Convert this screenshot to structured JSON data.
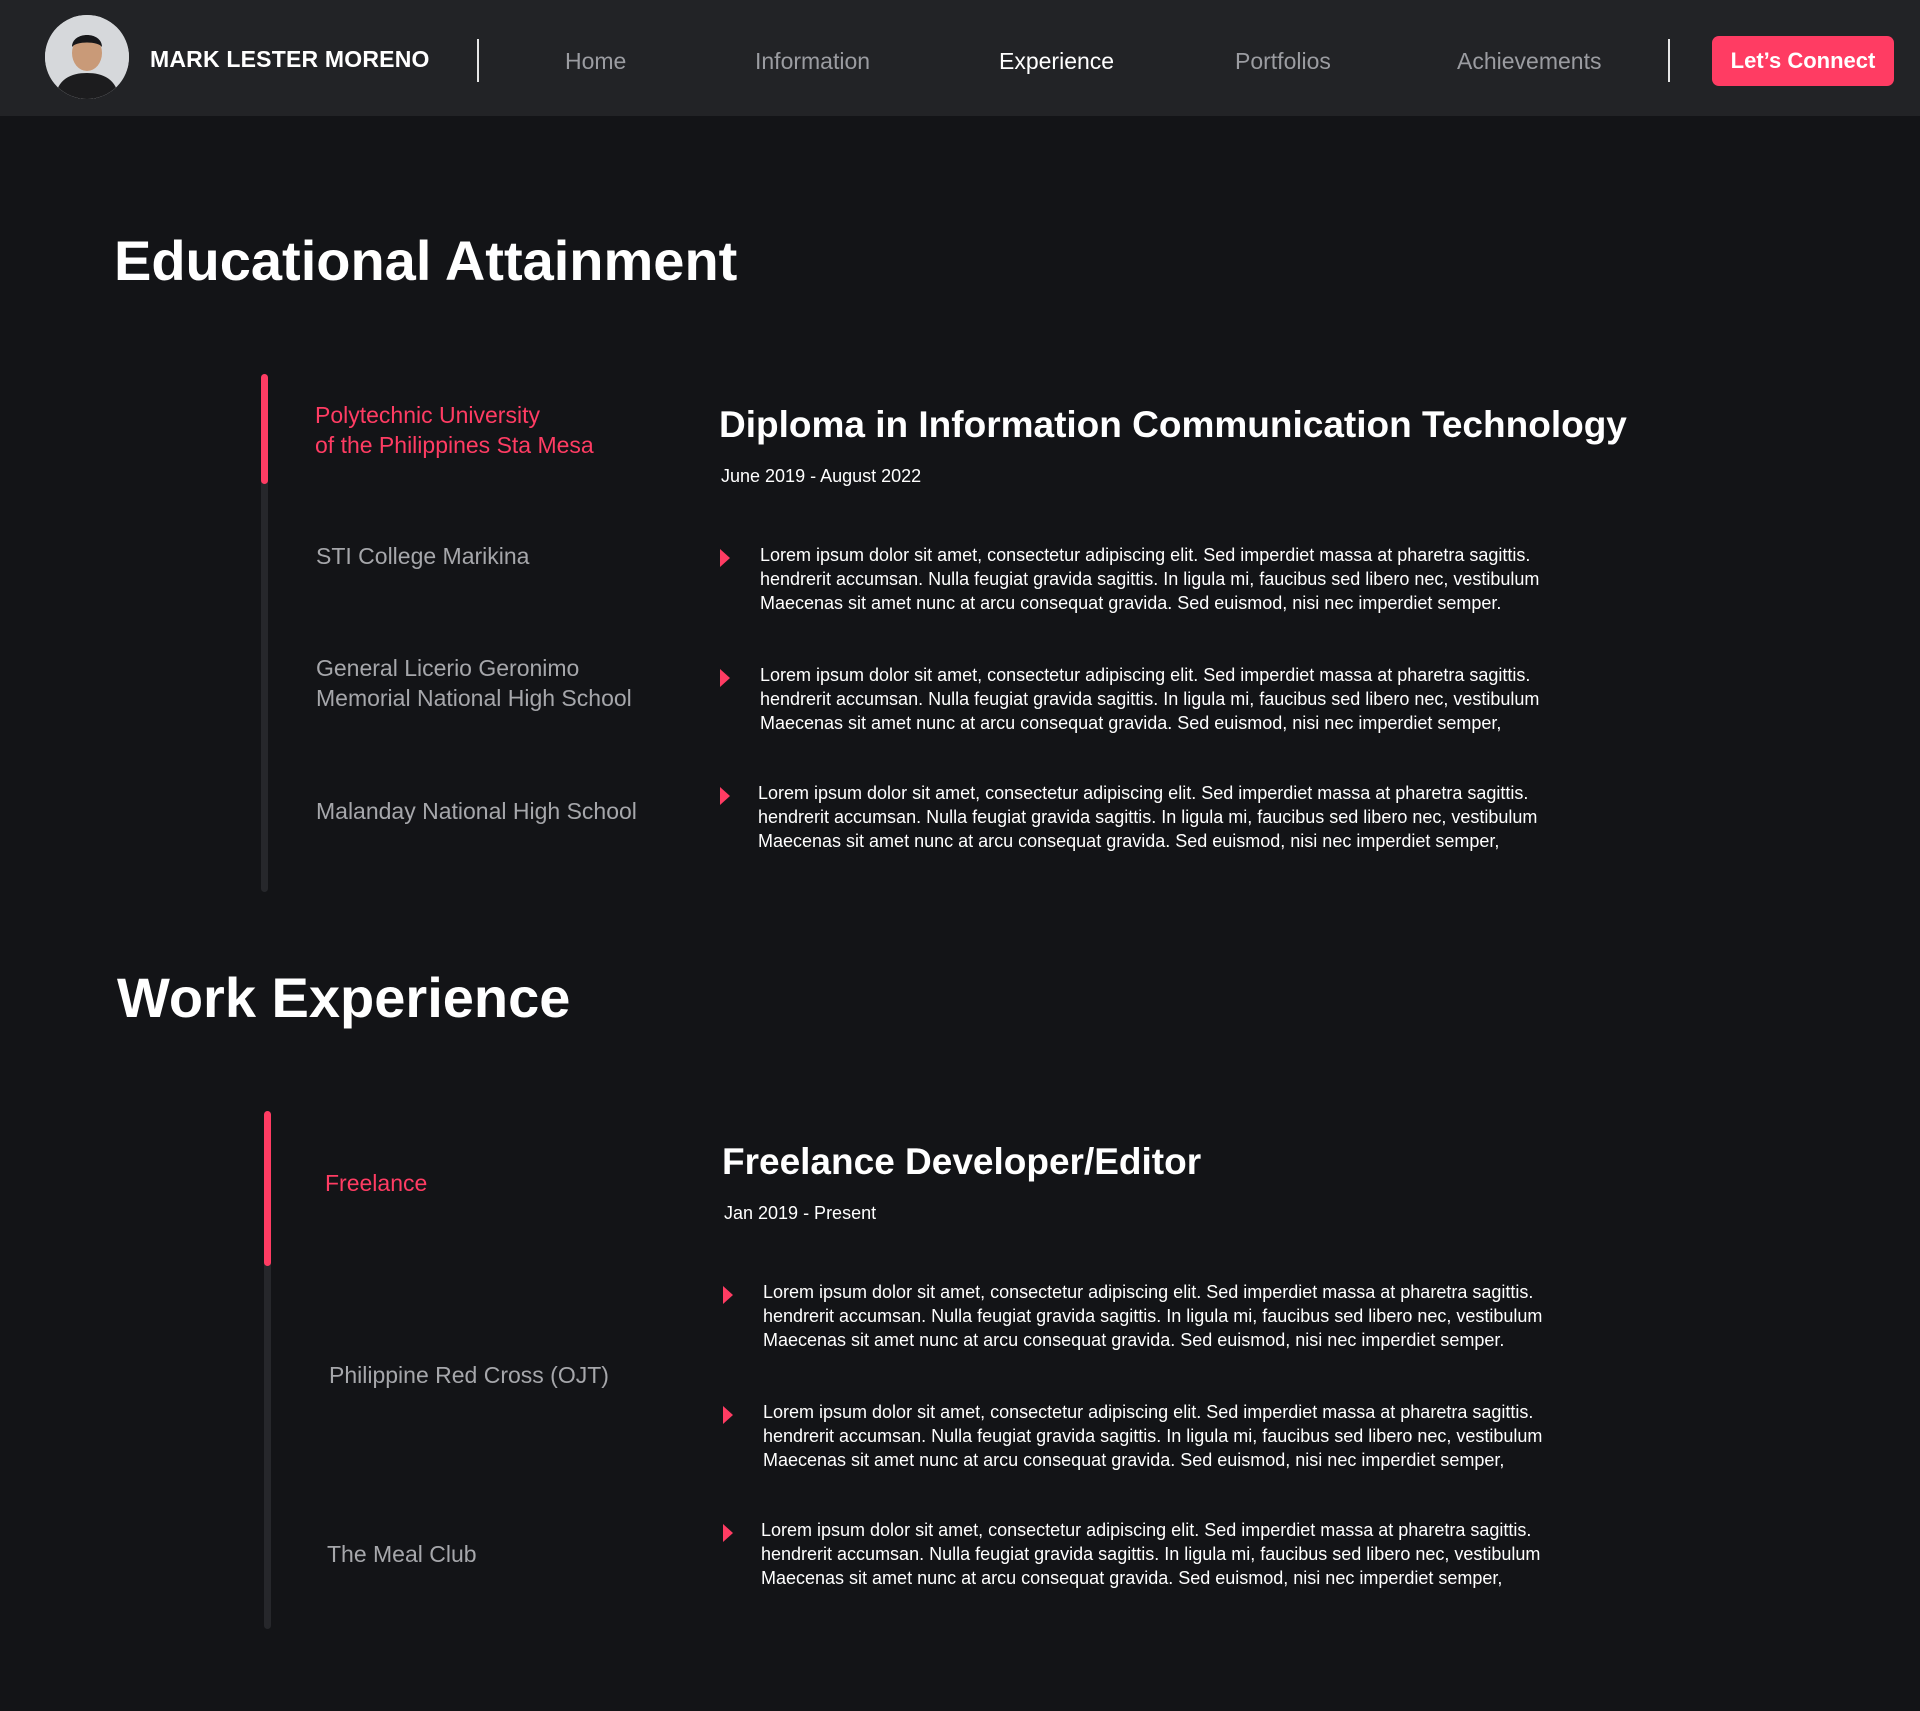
{
  "nav": {
    "brand_name": "MARK LESTER MORENO",
    "links": [
      "Home",
      "Information",
      "Experience",
      "Portfolios",
      "Achievements"
    ],
    "active_link": "Experience",
    "cta_label": "Let’s Connect",
    "accent_color": "#ff3c63"
  },
  "education": {
    "title": "Educational Attainment",
    "schools": [
      {
        "lines": [
          "Polytechnic University",
          "of the Philippines Sta Mesa"
        ],
        "active": true
      },
      {
        "lines": [
          "STI College Marikina"
        ],
        "active": false
      },
      {
        "lines": [
          "General Licerio Geronimo",
          "Memorial National High School"
        ],
        "active": false
      },
      {
        "lines": [
          "Malanday National High School"
        ],
        "active": false
      }
    ],
    "detail": {
      "title": "Diploma in Information Communication Technology",
      "date": "June 2019 - August 2022",
      "bullets": [
        [
          "Lorem ipsum dolor sit amet, consectetur adipiscing elit. Sed imperdiet massa at pharetra sagittis.",
          "hendrerit accumsan. Nulla feugiat gravida sagittis. In ligula mi, faucibus sed libero nec, vestibulum",
          "Maecenas sit amet nunc at arcu consequat gravida. Sed euismod, nisi nec imperdiet semper."
        ],
        [
          "Lorem ipsum dolor sit amet, consectetur adipiscing elit. Sed imperdiet massa at pharetra sagittis.",
          "hendrerit accumsan. Nulla feugiat gravida sagittis. In ligula mi, faucibus sed libero nec, vestibulum",
          "Maecenas sit amet nunc at arcu consequat gravida. Sed euismod, nisi nec imperdiet semper,"
        ],
        [
          "Lorem ipsum dolor sit amet, consectetur adipiscing elit. Sed imperdiet massa at pharetra sagittis.",
          "hendrerit accumsan. Nulla feugiat gravida sagittis. In ligula mi, faucibus sed libero nec, vestibulum",
          "Maecenas sit amet nunc at arcu consequat gravida. Sed euismod, nisi nec imperdiet semper,"
        ]
      ]
    }
  },
  "work": {
    "title": "Work Experience",
    "jobs": [
      {
        "lines": [
          "Freelance"
        ],
        "active": true
      },
      {
        "lines": [
          "Philippine Red Cross (OJT)"
        ],
        "active": false
      },
      {
        "lines": [
          "The Meal Club"
        ],
        "active": false
      }
    ],
    "detail": {
      "title": "Freelance Developer/Editor",
      "date": "Jan 2019 - Present",
      "bullets": [
        [
          "Lorem ipsum dolor sit amet, consectetur adipiscing elit. Sed imperdiet massa at pharetra sagittis.",
          "hendrerit accumsan. Nulla feugiat gravida sagittis. In ligula mi, faucibus sed libero nec, vestibulum",
          "Maecenas sit amet nunc at arcu consequat gravida. Sed euismod, nisi nec imperdiet semper."
        ],
        [
          "Lorem ipsum dolor sit amet, consectetur adipiscing elit. Sed imperdiet massa at pharetra sagittis.",
          "hendrerit accumsan. Nulla feugiat gravida sagittis. In ligula mi, faucibus sed libero nec, vestibulum",
          "Maecenas sit amet nunc at arcu consequat gravida. Sed euismod, nisi nec imperdiet semper,"
        ],
        [
          "Lorem ipsum dolor sit amet, consectetur adipiscing elit. Sed imperdiet massa at pharetra sagittis.",
          "hendrerit accumsan. Nulla feugiat gravida sagittis. In ligula mi, faucibus sed libero nec, vestibulum",
          "Maecenas sit amet nunc at arcu consequat gravida. Sed euismod, nisi nec imperdiet semper,"
        ]
      ]
    }
  }
}
